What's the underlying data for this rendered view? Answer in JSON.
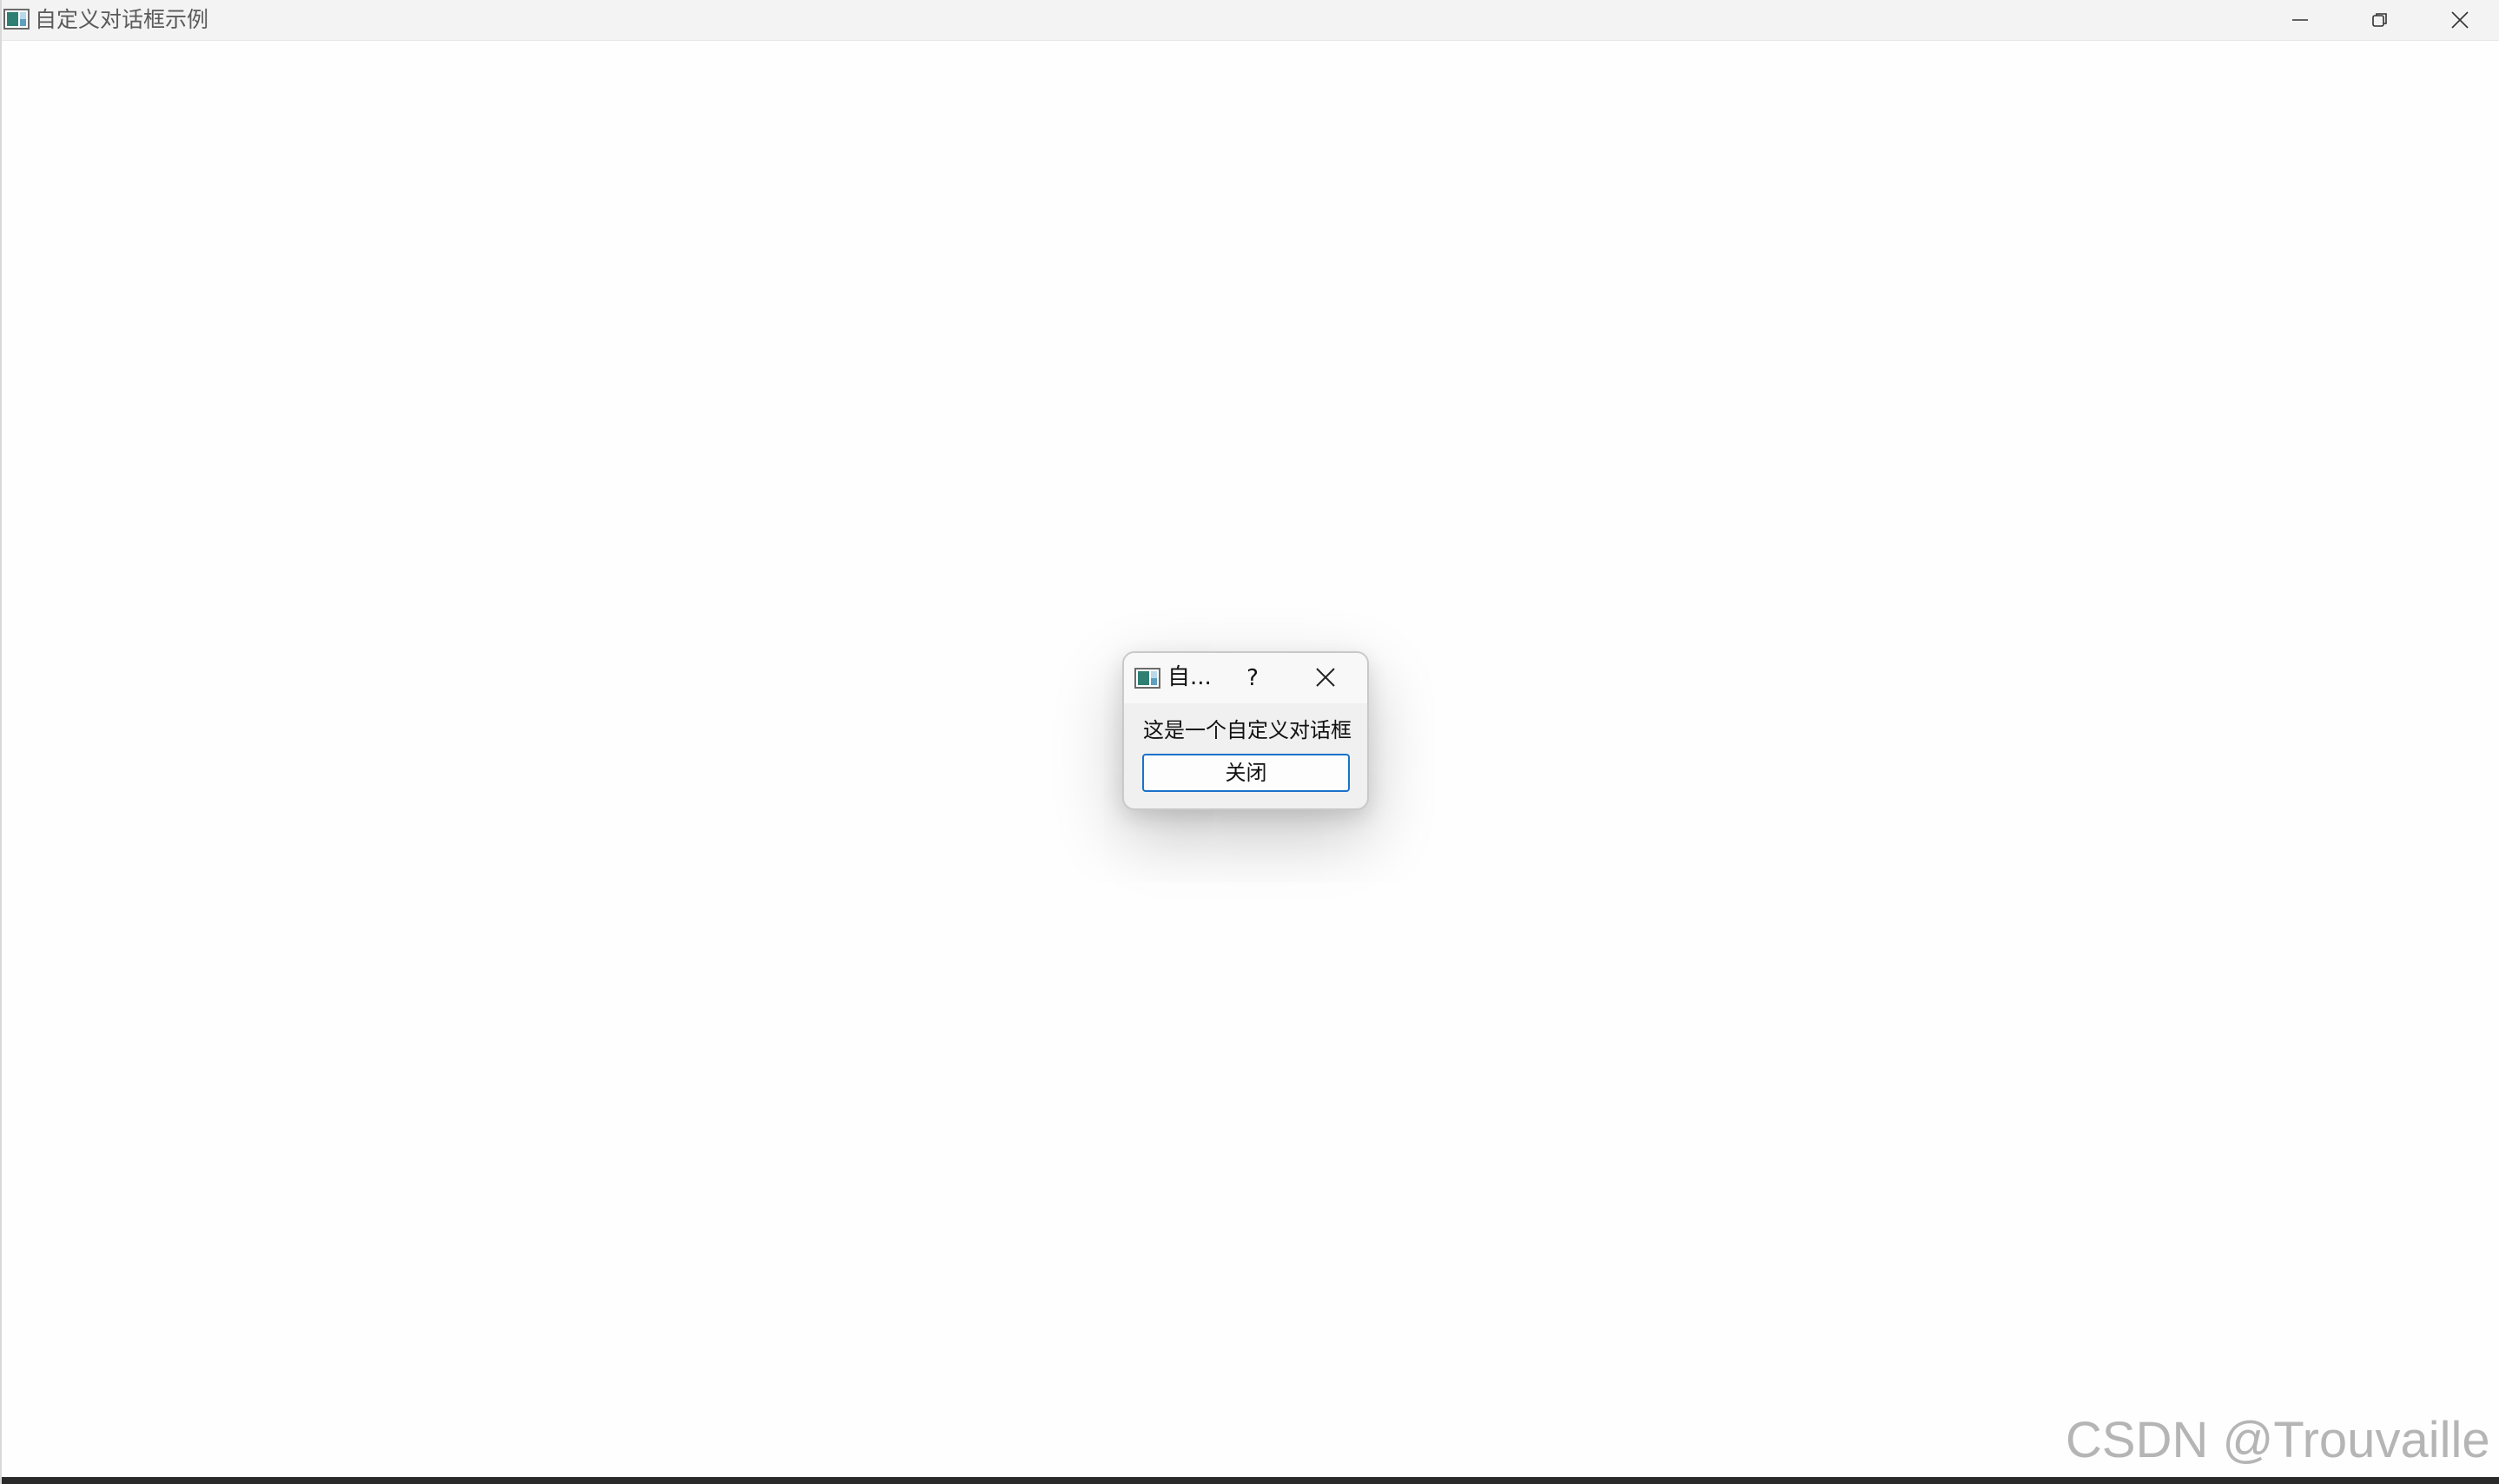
{
  "main_window": {
    "title": "自定义对话框示例",
    "app_icon": "window-app-icon",
    "controls": {
      "minimize_icon": "minimize-icon",
      "maximize_icon": "restore-icon",
      "close_icon": "close-icon"
    }
  },
  "dialog": {
    "title": "自...",
    "help_label": "?",
    "close_icon": "close-icon",
    "message": "这是一个自定义对话框",
    "close_button_label": "关闭"
  },
  "watermark": "CSDN @Trouvaille ~",
  "colors": {
    "accent": "#1a73c9",
    "titlebar": "#f3f3f3",
    "dialog_bg": "#f0f0f0"
  }
}
